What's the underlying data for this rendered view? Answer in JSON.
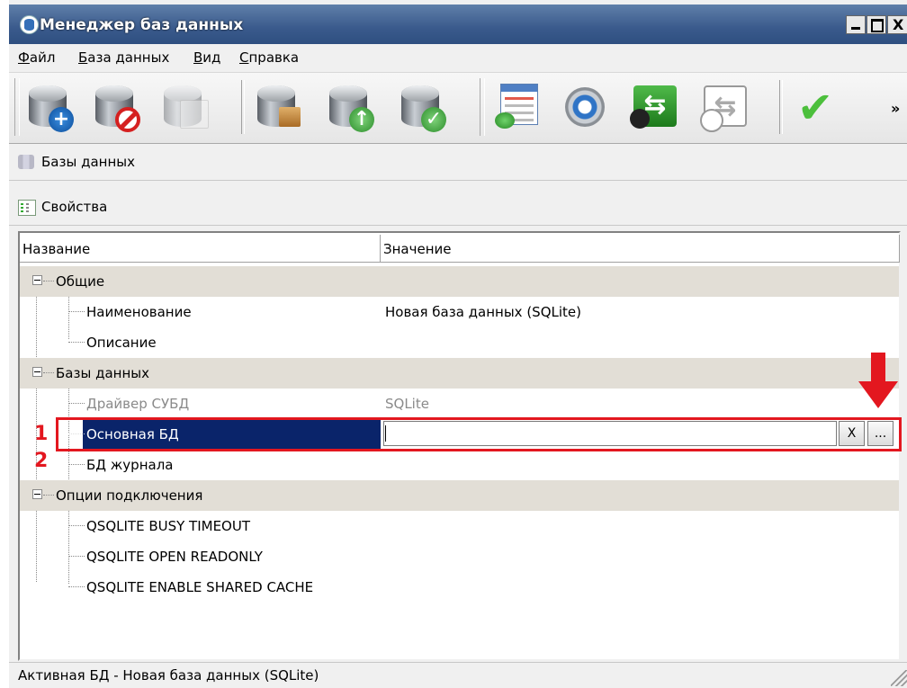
{
  "window": {
    "title": "Менеджер баз данных",
    "buttons": {
      "minimize": "_",
      "maximize": "□",
      "close": "X"
    }
  },
  "menu": [
    "Файл",
    "База данных",
    "Вид",
    "Справка"
  ],
  "toolbar": {
    "icons": [
      "add-database-icon",
      "remove-database-icon",
      "edit-database-icon",
      "database-package-icon",
      "database-upload-icon",
      "database-check-icon",
      "window-settings-icon",
      "gear-icon",
      "transfer-icon",
      "transfer-disabled-icon",
      "checkmark-icon"
    ],
    "overflow": "»"
  },
  "sections": {
    "databases": "Базы данных",
    "properties": "Свойства"
  },
  "grid": {
    "columns": [
      "Название",
      "Значение"
    ],
    "groups": {
      "general": "Общие",
      "databases": "Базы данных",
      "connection": "Опции подключения"
    },
    "rows": [
      {
        "name": "Наименование",
        "value": "Новая база данных (SQLite)"
      },
      {
        "name": "Описание",
        "value": ""
      },
      {
        "name": "Драйвер СУБД",
        "value": "SQLite"
      },
      {
        "name": "Основная БД",
        "value": ""
      },
      {
        "name": "БД журнала",
        "value": ""
      },
      {
        "name": "QSQLITE BUSY TIMEOUT",
        "value": ""
      },
      {
        "name": "QSQLITE OPEN READONLY",
        "value": ""
      },
      {
        "name": "QSQLITE ENABLE SHARED CACHE",
        "value": ""
      }
    ],
    "editor_buttons": {
      "clear": "X",
      "browse": "..."
    }
  },
  "annotations": [
    "1",
    "2"
  ],
  "status": "Активная БД - Новая база данных (SQLite)",
  "colors": {
    "titlebar": "#3a5a8c",
    "selection": "#0a246a",
    "annotation": "#e3171f"
  }
}
